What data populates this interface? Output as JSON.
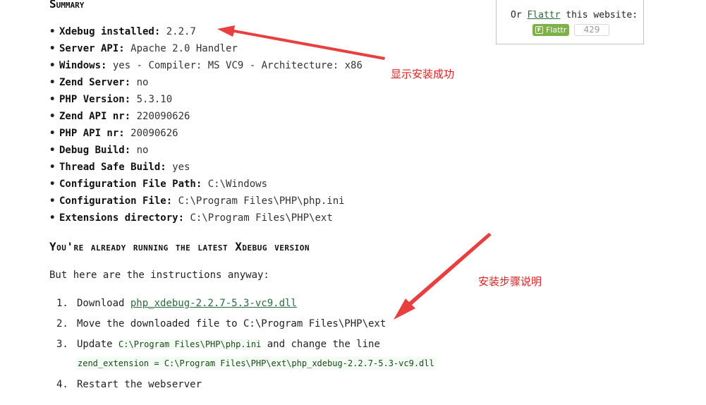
{
  "summary": {
    "heading": "Summary",
    "items": [
      {
        "key": "Xdebug installed:",
        "value": "2.2.7"
      },
      {
        "key": "Server API:",
        "value": "Apache 2.0 Handler"
      },
      {
        "key": "Windows:",
        "value": "yes - Compiler: MS VC9 - Architecture: x86"
      },
      {
        "key": "Zend Server:",
        "value": "no"
      },
      {
        "key": "PHP Version:",
        "value": "5.3.10"
      },
      {
        "key": "Zend API nr:",
        "value": "220090626"
      },
      {
        "key": "PHP API nr:",
        "value": "20090626"
      },
      {
        "key": "Debug Build:",
        "value": "no"
      },
      {
        "key": "Thread Safe Build:",
        "value": "yes"
      },
      {
        "key": "Configuration File Path:",
        "value": "C:\\Windows"
      },
      {
        "key": "Configuration File:",
        "value": "C:\\Program Files\\PHP\\php.ini"
      },
      {
        "key": "Extensions directory:",
        "value": "C:\\Program Files\\PHP\\ext"
      }
    ]
  },
  "latest": {
    "heading": "You're already running the latest Xdebug version",
    "intro": "But here are the instructions anyway:"
  },
  "steps": {
    "s1": {
      "num": "1.",
      "text": "Download ",
      "link": "php_xdebug-2.2.7-5.3-vc9.dll"
    },
    "s2": {
      "num": "2.",
      "text": "Move the downloaded file to C:\\Program Files\\PHP\\ext"
    },
    "s3": {
      "num": "3.",
      "pre": "Update ",
      "code": "C:\\Program Files\\PHP\\php.ini",
      "post": " and change the line"
    },
    "s3_code": "zend_extension = C:\\Program Files\\PHP\\ext\\php_xdebug-2.2.7-5.3-vc9.dll",
    "s4": {
      "num": "4.",
      "text": "Restart the webserver"
    }
  },
  "flattr": {
    "pre": "Or ",
    "link": "Flattr",
    "post": " this website:",
    "button_label": "Flattr",
    "count": "429"
  },
  "annotations": {
    "installed_ok": "显示安装成功",
    "install_steps": "安装步骤说明"
  },
  "colors": {
    "annotation": "#e02020",
    "link": "#2b6a3c",
    "flattr_green": "#7fb04a"
  }
}
